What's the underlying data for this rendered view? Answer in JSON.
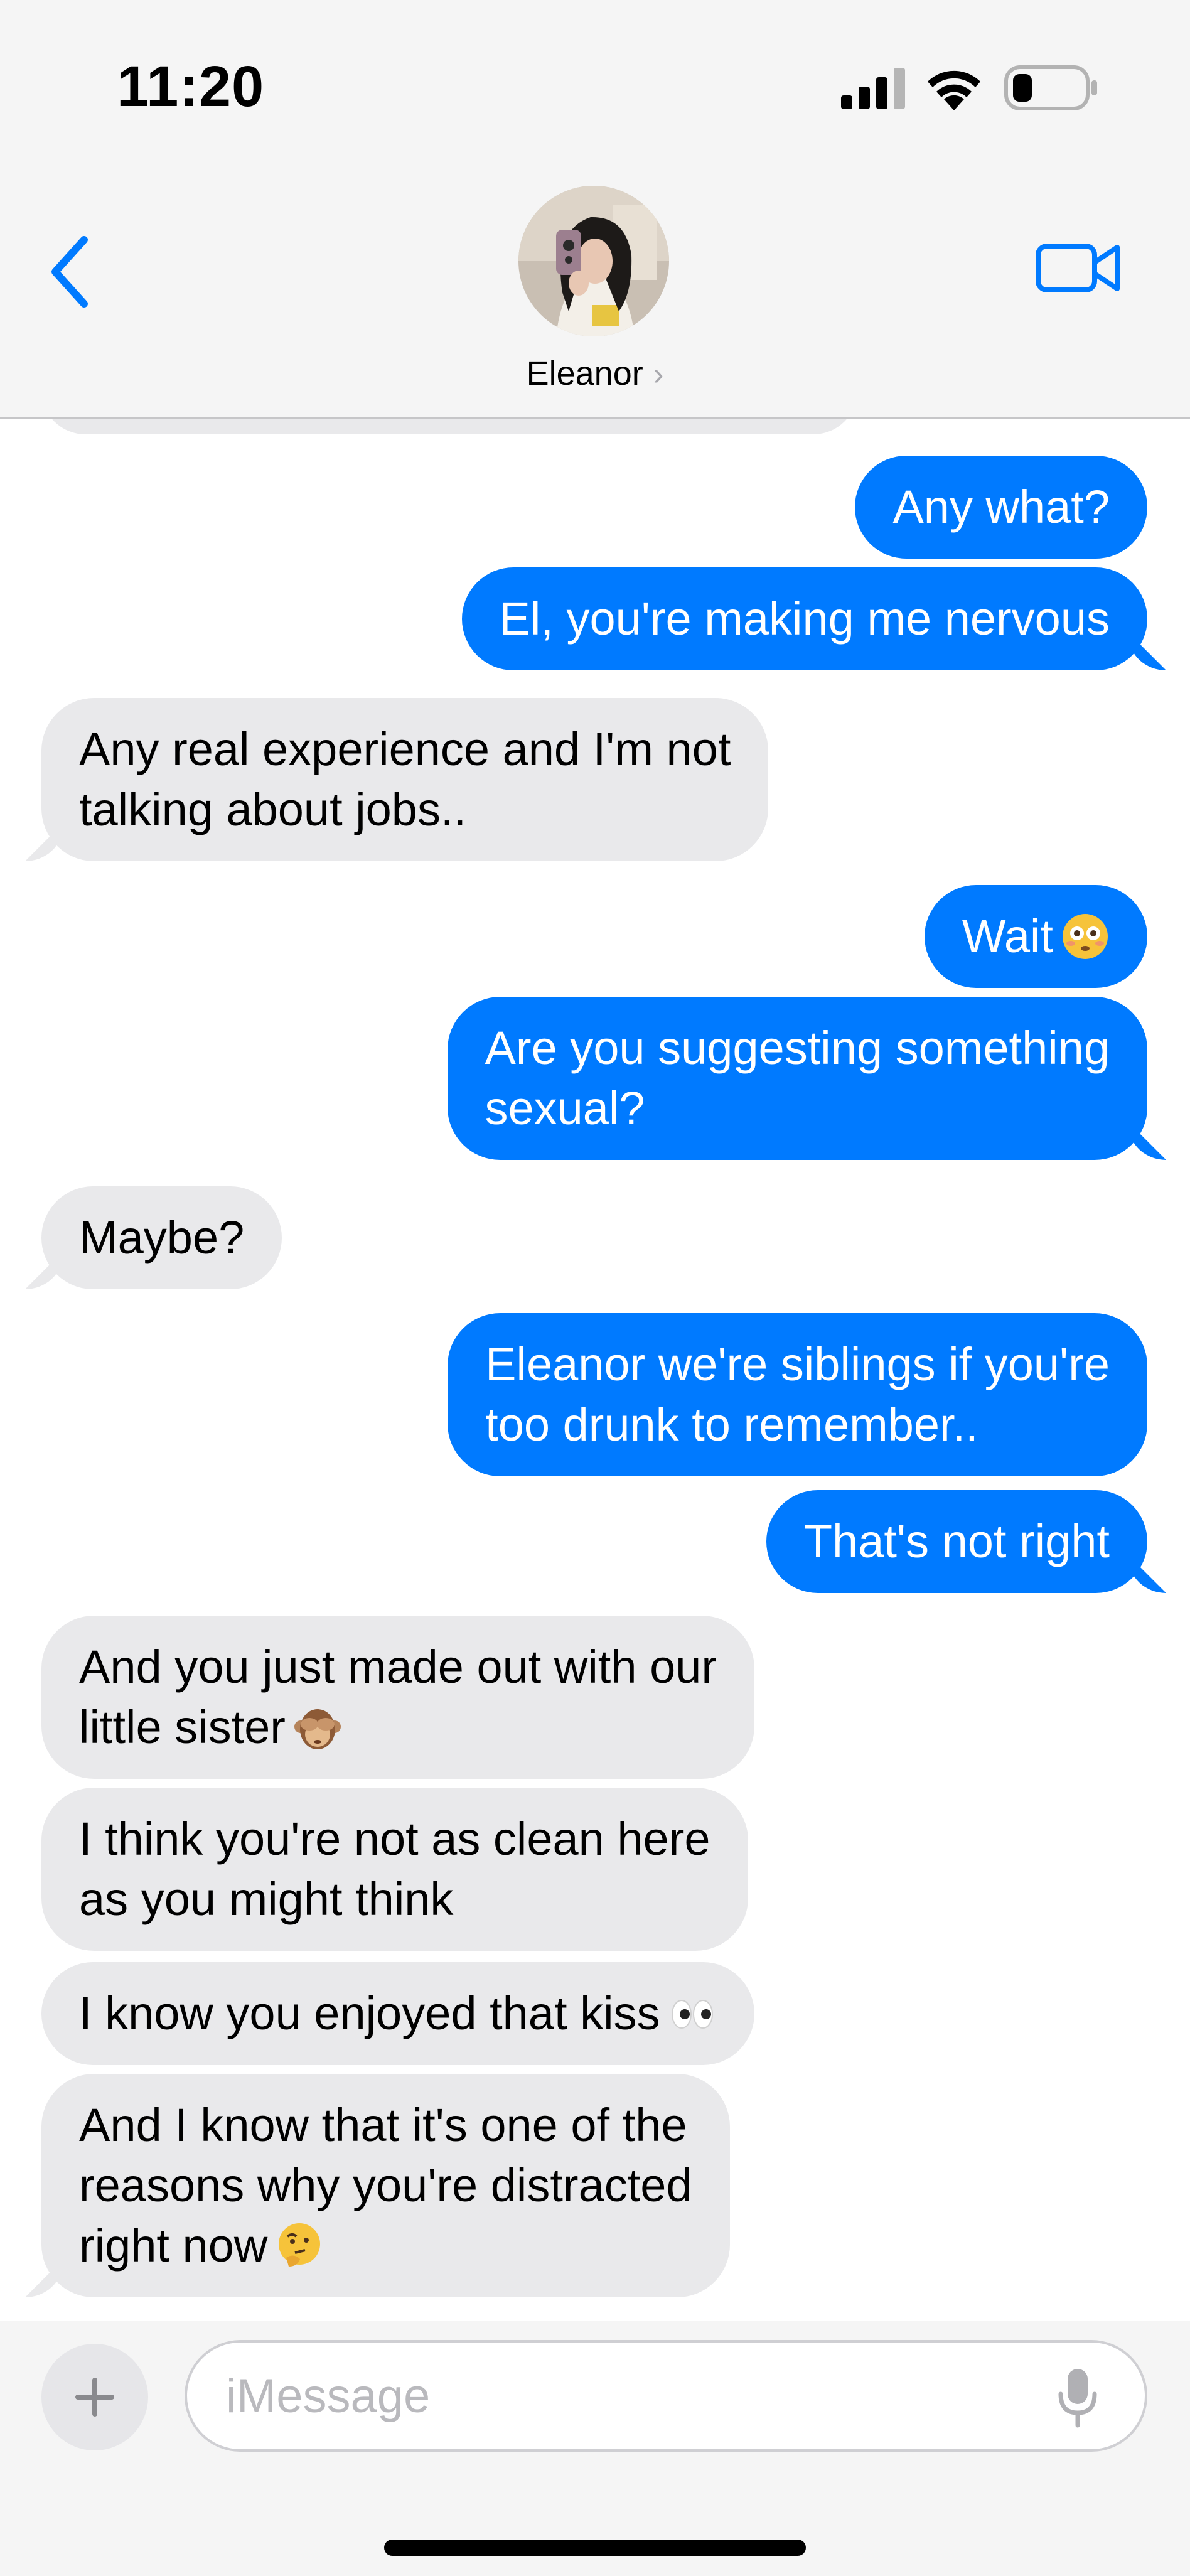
{
  "status_bar": {
    "time": "11:20"
  },
  "header": {
    "contact_name": "Eleanor",
    "name_chevron": "›"
  },
  "colors": {
    "sent_bubble": "#007aff",
    "received_bubble": "#e9e9eb",
    "accent": "#007aff"
  },
  "messages": [
    {
      "direction": "sent",
      "lines": [
        "Any what?"
      ]
    },
    {
      "direction": "sent",
      "lines": [
        "El, you're making me nervous"
      ]
    },
    {
      "direction": "received",
      "lines": [
        "Any real experience and I'm not",
        "talking about jobs.."
      ]
    },
    {
      "direction": "sent",
      "lines": [
        "Wait"
      ],
      "emoji": "flushed-face"
    },
    {
      "direction": "sent",
      "lines": [
        "Are you suggesting something",
        "sexual?"
      ]
    },
    {
      "direction": "received",
      "lines": [
        "Maybe?"
      ]
    },
    {
      "direction": "sent",
      "lines": [
        "Eleanor we're siblings if you're",
        "too drunk to remember.."
      ]
    },
    {
      "direction": "sent",
      "lines": [
        "That's not right"
      ]
    },
    {
      "direction": "received",
      "lines": [
        "And you just made out with our",
        "little sister"
      ],
      "emoji": "see-no-evil-monkey"
    },
    {
      "direction": "received",
      "lines": [
        "I think you're not as clean here",
        "as you might think"
      ]
    },
    {
      "direction": "received",
      "lines": [
        "I know you enjoyed that kiss"
      ],
      "emoji": "eyes"
    },
    {
      "direction": "received",
      "lines": [
        "And I know that it's one of the",
        "reasons why you're distracted",
        "right now"
      ],
      "emoji": "thinking-face"
    }
  ],
  "composer": {
    "placeholder": "iMessage"
  },
  "icons": {
    "back": "chevron-left-icon",
    "video": "video-camera-icon",
    "plus": "plus-icon",
    "mic": "microphone-icon"
  }
}
